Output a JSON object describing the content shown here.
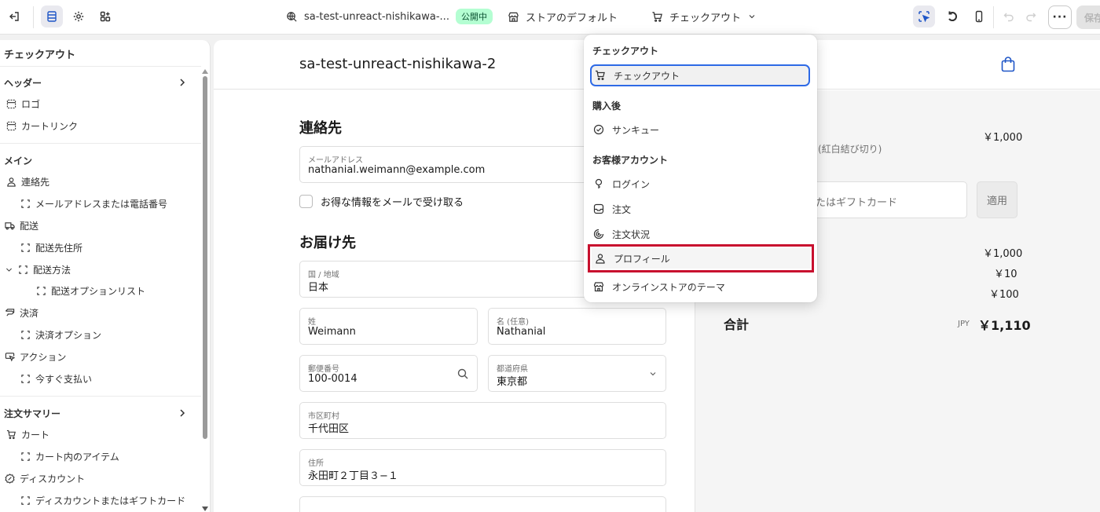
{
  "topbar": {
    "store_label": "sa-test-unreact-nishikawa-...",
    "status_badge": "公開中",
    "theme_label": "ストアのデフォルト",
    "page_selector_label": "チェックアウト",
    "more_label": "···",
    "save_label": "保存"
  },
  "sidebar": {
    "title": "チェックアウト",
    "sections": {
      "header": {
        "label": "ヘッダー",
        "items": [
          "ロゴ",
          "カートリンク"
        ]
      },
      "main": {
        "label": "メイン",
        "contact": "連絡先",
        "contact_child": "メールアドレスまたは電話番号",
        "shipping": "配送",
        "shipping_address": "配送先住所",
        "shipping_method": "配送方法",
        "shipping_options": "配送オプションリスト",
        "payment": "決済",
        "payment_options": "決済オプション",
        "actions": "アクション",
        "pay_now": "今すぐ支払い"
      },
      "summary": {
        "label": "注文サマリー",
        "cart": "カート",
        "cart_items": "カート内のアイテム",
        "discount": "ディスカウント",
        "discount_child": "ディスカウントまたはギフトカード"
      }
    }
  },
  "preview": {
    "store_name": "sa-test-unreact-nishikawa-2",
    "contact_heading": "連絡先",
    "email_label": "メールアドレス",
    "email_value": "nathanial.weimann@example.com",
    "newsletter_label": "お得な情報をメールで受け取る",
    "delivery_heading": "お届け先",
    "country_label": "国 / 地域",
    "country_value": "日本",
    "last_name_label": "姓",
    "last_name_value": "Weimann",
    "first_name_label": "名 (任意)",
    "first_name_value": "Nathanial",
    "postal_label": "郵便番号",
    "postal_value": "100-0014",
    "prefecture_label": "都道府県",
    "prefecture_value": "東京都",
    "city_label": "市区町村",
    "city_value": "千代田区",
    "address_label": "住所",
    "address_value": "永田町２丁目３−１",
    "summary": {
      "item_price": "￥1,000",
      "item_variant": "(紅白結び切り)",
      "discount_placeholder": "たはギフトカード",
      "apply_label": "適用",
      "subtotal": "￥1,000",
      "shipping": "￥10",
      "tax": "￥100",
      "total_label": "合計",
      "currency": "JPY",
      "total_value": "￥1,110"
    }
  },
  "dropdown": {
    "group_checkout": "チェックアウト",
    "item_checkout": "チェックアウト",
    "group_post_purchase": "購入後",
    "item_thank_you": "サンキュー",
    "group_customer_account": "お客様アカウント",
    "item_login": "ログイン",
    "item_orders": "注文",
    "item_order_status": "注文状況",
    "item_profile": "プロフィール",
    "item_theme": "オンラインストアのテーマ"
  },
  "colors": {
    "accent_blue": "#2e6ae6",
    "highlight_red": "#c8102e",
    "badge_green": "#b4fed2"
  }
}
